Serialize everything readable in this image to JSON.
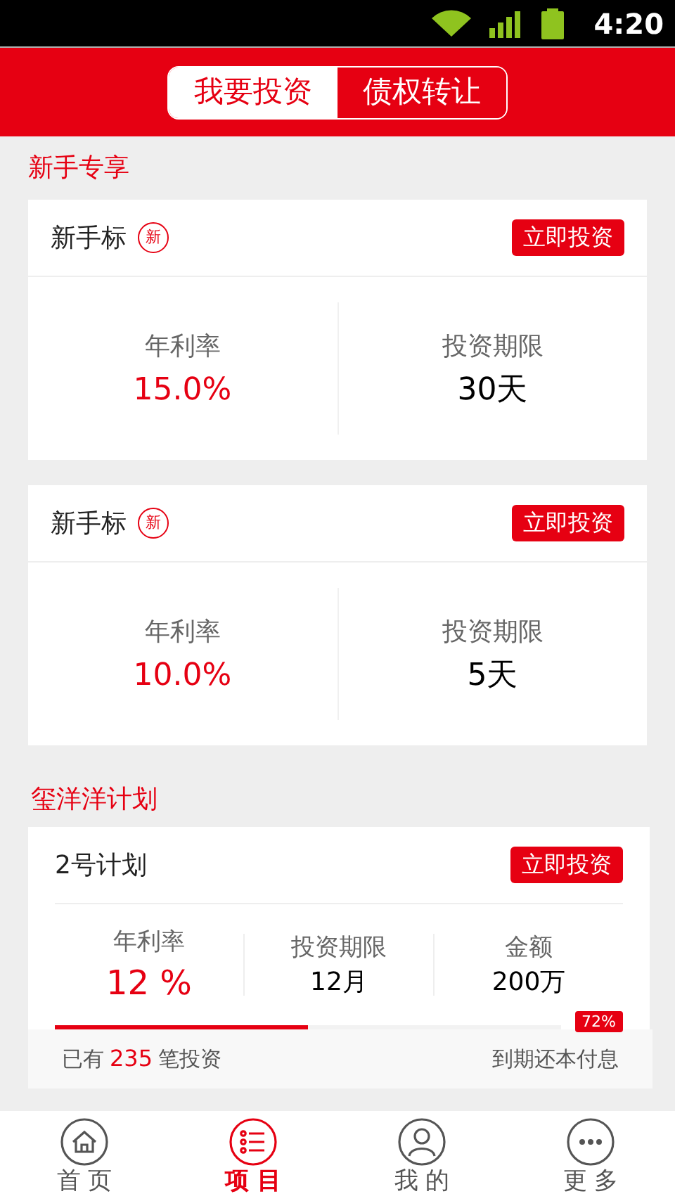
{
  "status_bar": {
    "time": "4:20"
  },
  "tabs": [
    {
      "label": "我要投资",
      "selected": true
    },
    {
      "label": "债权转让",
      "selected": false
    }
  ],
  "sections": [
    {
      "title": "新手专享",
      "cards": [
        {
          "kind": "simple",
          "name": "新手标",
          "badge": "新",
          "button": "立即投资",
          "stats": [
            {
              "label": "年利率",
              "value": "15.0%",
              "highlight": true
            },
            {
              "label": "投资期限",
              "value": "30天",
              "highlight": false
            }
          ]
        },
        {
          "kind": "simple",
          "name": "新手标",
          "badge": "新",
          "button": "立即投资",
          "stats": [
            {
              "label": "年利率",
              "value": "10.0%",
              "highlight": true
            },
            {
              "label": "投资期限",
              "value": "5天",
              "highlight": false
            }
          ]
        }
      ]
    },
    {
      "title": "玺洋洋计划",
      "cards": [
        {
          "kind": "plan",
          "name": "2号计划",
          "button": "立即投资",
          "stats": [
            {
              "label": "年利率",
              "value": "12 %",
              "highlight": true
            },
            {
              "label": "投资期限",
              "value": "12月",
              "highlight": false
            },
            {
              "label": "金额",
              "value": "200万",
              "highlight": false
            }
          ],
          "progress": {
            "level": 0.5,
            "label": "72%"
          },
          "count_prefix": "已有",
          "count": "235",
          "count_suffix": "笔投资",
          "repayment": "到期还本付息"
        }
      ]
    }
  ],
  "nav": [
    {
      "kind": "home",
      "label": "首 页",
      "selected": false
    },
    {
      "kind": "list",
      "label": "项 目",
      "selected": true
    },
    {
      "kind": "user",
      "label": "我 的",
      "selected": false
    },
    {
      "kind": "more",
      "label": "更 多",
      "selected": false
    }
  ]
}
